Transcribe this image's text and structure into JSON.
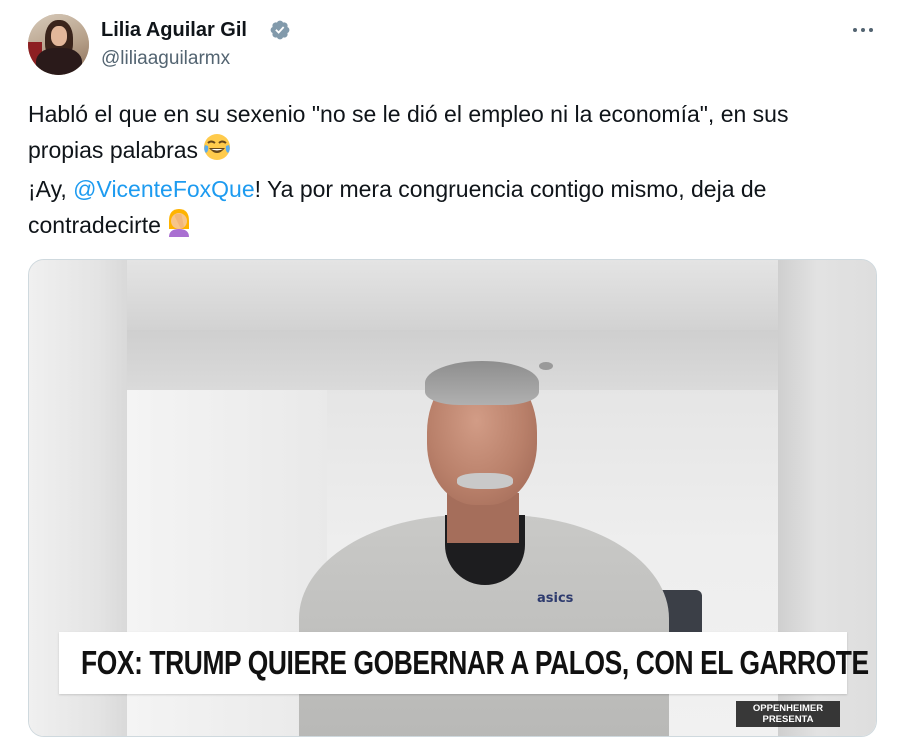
{
  "author": {
    "name": "Lilia Aguilar Gil",
    "handle": "@liliaaguilarmx",
    "verified_icon": "verified-badge-icon",
    "verified_color": "#829aab"
  },
  "menu_icon": "more-horizontal-icon",
  "tweet": {
    "line1": "Habló el que en su sexenio \"no se le dió el empleo ni la economía\", en sus",
    "line2_text": "propias palabras",
    "line2_emoji": "😂",
    "line3_prefix": "¡Ay, ",
    "line3_mention": "@VicenteFoxQue",
    "line3_suffix": "! Ya por mera congruencia contigo mismo, deja de",
    "line4_text": "contradecirte",
    "line4_emoji": "🤦‍♀️",
    "mention_color": "#1d9bf0"
  },
  "media": {
    "chyron": "FOX: TRUMP QUIERE GOBERNAR A PALOS, CON EL GARROTE",
    "bug_line1": "OPPENHEIMER",
    "bug_line2": "PRESENTA",
    "shirt_logo": "asics"
  }
}
